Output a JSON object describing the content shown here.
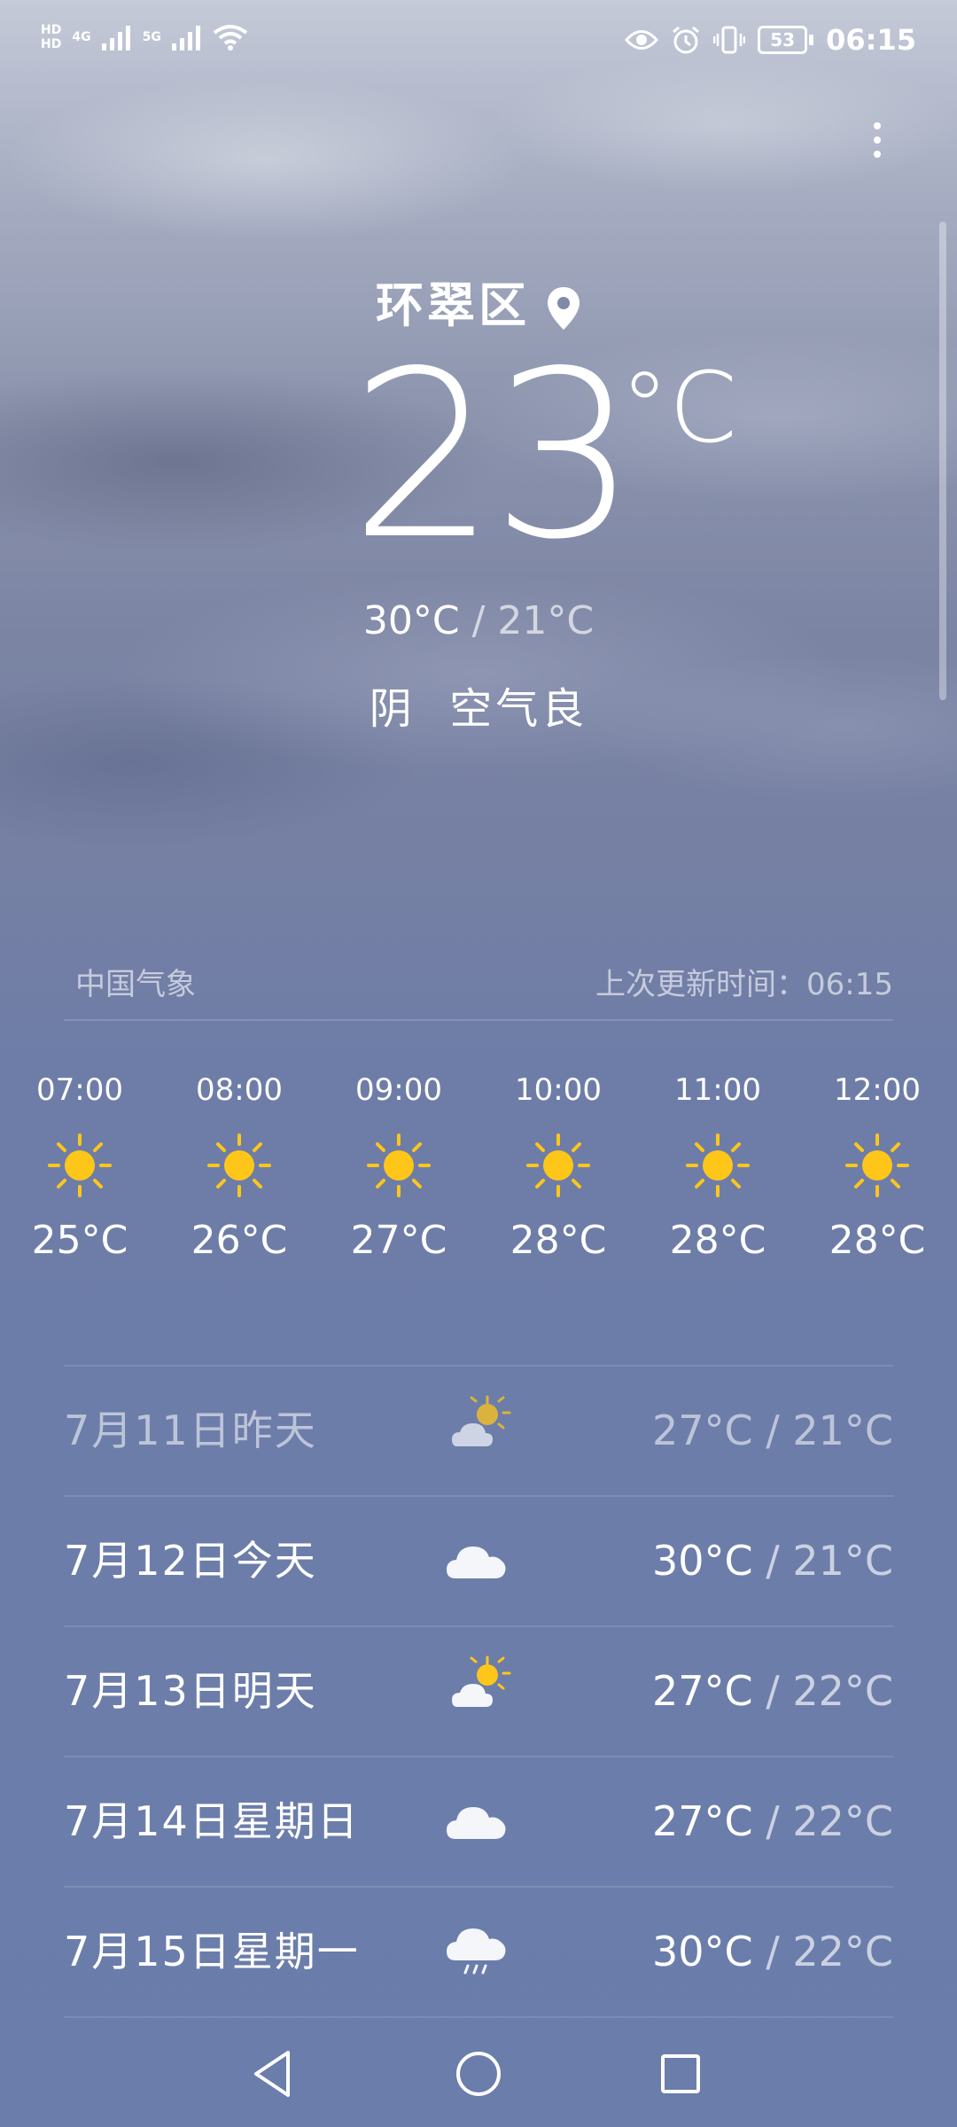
{
  "status_bar": {
    "hd1": "HD",
    "hd2": "HD",
    "net1": "4G",
    "net2": "5G",
    "battery": "53",
    "time": "06:15"
  },
  "location": "环翠区",
  "current": {
    "temp": "23",
    "unit": "°C",
    "high": "30°C",
    "low": "21°C",
    "separator": "/",
    "condition": "阴",
    "air_quality": "空气良"
  },
  "source": "中国气象",
  "last_updated": "上次更新时间：06:15",
  "hourly": [
    {
      "time": "07:00",
      "icon": "sun-icon",
      "temp": "25°C"
    },
    {
      "time": "08:00",
      "icon": "sun-icon",
      "temp": "26°C"
    },
    {
      "time": "09:00",
      "icon": "sun-icon",
      "temp": "27°C"
    },
    {
      "time": "10:00",
      "icon": "sun-icon",
      "temp": "28°C"
    },
    {
      "time": "11:00",
      "icon": "sun-icon",
      "temp": "28°C"
    },
    {
      "time": "12:00",
      "icon": "sun-icon",
      "temp": "28°C"
    }
  ],
  "daily": [
    {
      "date": "7月11日昨天",
      "icon": "partly-cloudy-icon",
      "high": "27°C",
      "low": "21°C"
    },
    {
      "date": "7月12日今天",
      "icon": "cloud-icon",
      "high": "30°C",
      "low": "21°C"
    },
    {
      "date": "7月13日明天",
      "icon": "partly-cloudy-icon",
      "high": "27°C",
      "low": "22°C"
    },
    {
      "date": "7月14日星期日",
      "icon": "cloud-icon",
      "high": "27°C",
      "low": "22°C"
    },
    {
      "date": "7月15日星期一",
      "icon": "rain-icon",
      "high": "30°C",
      "low": "22°C"
    }
  ],
  "colors": {
    "sun": "#ffc61a",
    "text": "#ffffff",
    "background": "#6a7dab"
  }
}
